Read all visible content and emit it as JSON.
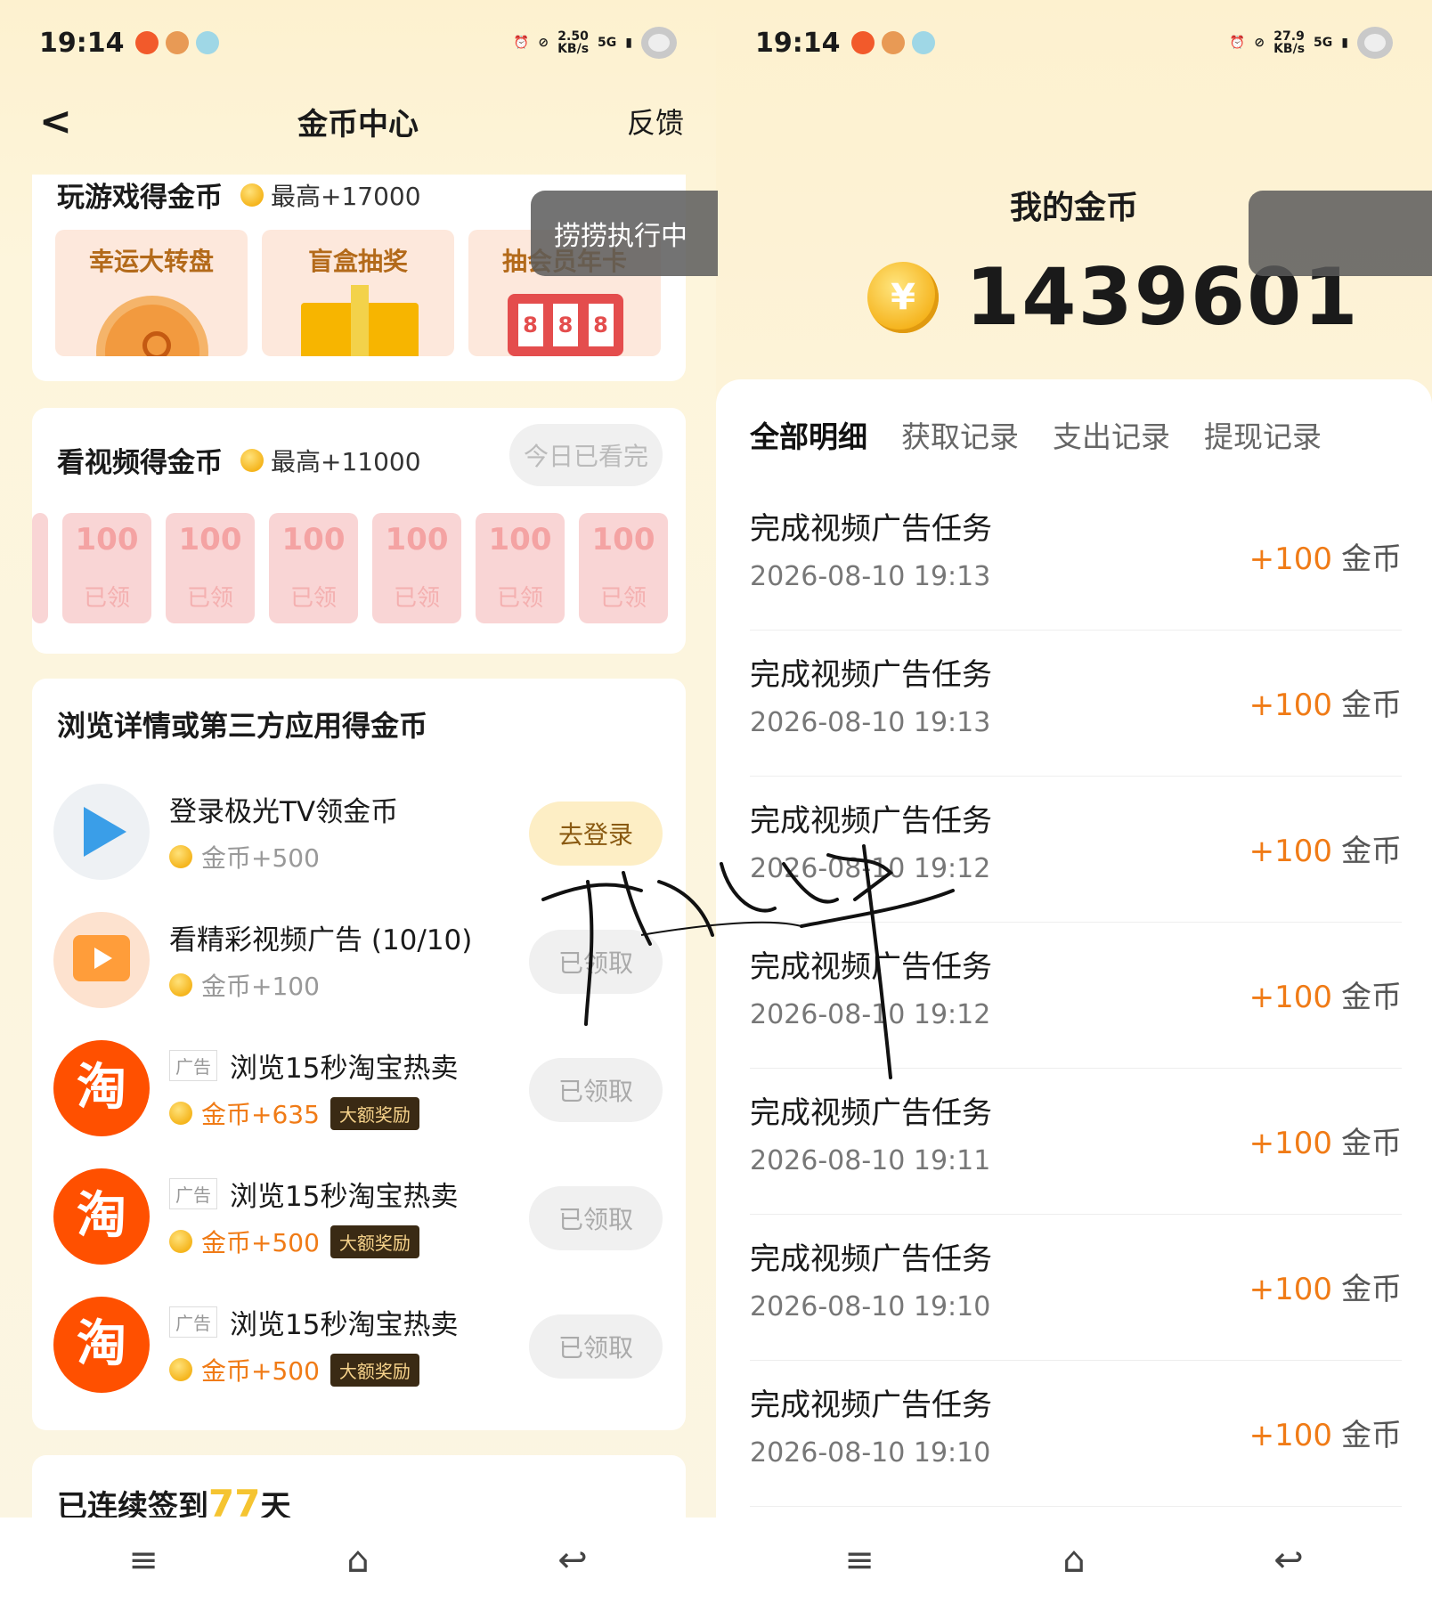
{
  "left": {
    "status": {
      "time": "19:14",
      "speed": "2.50",
      "speed_unit": "KB/s",
      "net": "5G"
    },
    "header": {
      "back": "<",
      "title": "金币中心",
      "feedback": "反馈"
    },
    "games": {
      "title": "玩游戏得金币",
      "max": "最高+17000",
      "tiles": [
        "幸运大转盘",
        "盲盒抽奖",
        "抽会员年卡"
      ],
      "slot_digits": [
        "8",
        "8",
        "8"
      ]
    },
    "toast": "捞捞执行中",
    "video": {
      "title": "看视频得金币",
      "max": "最高+11000",
      "status": "今日已看完",
      "envelopes": [
        {
          "amount": "100",
          "state": "已领"
        },
        {
          "amount": "100",
          "state": "已领"
        },
        {
          "amount": "100",
          "state": "已领"
        },
        {
          "amount": "100",
          "state": "已领"
        },
        {
          "amount": "100",
          "state": "已领"
        },
        {
          "amount": "100",
          "state": "已领"
        }
      ]
    },
    "tasks": {
      "title": "浏览详情或第三方应用得金币",
      "items": [
        {
          "name": "登录极光TV领金币",
          "reward": "金币+500",
          "button": "去登录"
        },
        {
          "name": "看精彩视频广告 (10/10)",
          "reward": "金币+100",
          "button": "已领取"
        },
        {
          "ad": "广告",
          "name": "浏览15秒淘宝热卖",
          "reward": "金币+635",
          "badge": "大额奖励",
          "button": "已领取",
          "icon_text": "淘"
        },
        {
          "ad": "广告",
          "name": "浏览15秒淘宝热卖",
          "reward": "金币+500",
          "badge": "大额奖励",
          "button": "已领取",
          "icon_text": "淘"
        },
        {
          "ad": "广告",
          "name": "浏览15秒淘宝热卖",
          "reward": "金币+500",
          "badge": "大额奖励",
          "button": "已领取",
          "icon_text": "淘"
        }
      ]
    },
    "signin": {
      "prefix": "已连续签到",
      "days": "77",
      "suffix": "天"
    }
  },
  "right": {
    "status": {
      "time": "19:14",
      "speed": "27.9",
      "speed_unit": "KB/s",
      "net": "5G"
    },
    "my_coins_label": "我的金币",
    "coin_symbol": "¥",
    "coin_count": "1439601",
    "tabs": [
      "全部明细",
      "获取记录",
      "支出记录",
      "提现记录"
    ],
    "records": [
      {
        "title": "完成视频广告任务",
        "date": "2026-08-10 19:13",
        "amount": "+100",
        "unit": "金币"
      },
      {
        "title": "完成视频广告任务",
        "date": "2026-08-10 19:13",
        "amount": "+100",
        "unit": "金币"
      },
      {
        "title": "完成视频广告任务",
        "date": "2026-08-10 19:12",
        "amount": "+100",
        "unit": "金币"
      },
      {
        "title": "完成视频广告任务",
        "date": "2026-08-10 19:12",
        "amount": "+100",
        "unit": "金币"
      },
      {
        "title": "完成视频广告任务",
        "date": "2026-08-10 19:11",
        "amount": "+100",
        "unit": "金币"
      },
      {
        "title": "完成视频广告任务",
        "date": "2026-08-10 19:10",
        "amount": "+100",
        "unit": "金币"
      },
      {
        "title": "完成视频广告任务",
        "date": "2026-08-10 19:10",
        "amount": "+100",
        "unit": "金币"
      }
    ]
  },
  "nav": {
    "menu": "≡",
    "home": "⌂",
    "back": "↩"
  },
  "colors": {
    "accent": "#f07b16",
    "taobao": "#ff5000",
    "coin": "#f5b51d"
  }
}
